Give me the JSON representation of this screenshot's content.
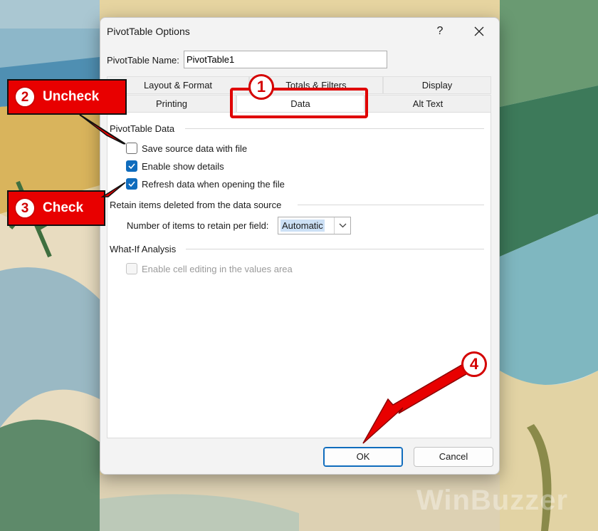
{
  "dialog": {
    "title": "PivotTable Options",
    "help_glyph": "?",
    "name_label": "PivotTable Name:",
    "name_label_accesskey": "N",
    "name_value": "PivotTable1"
  },
  "tabs": {
    "row1": [
      "Layout & Format",
      "Totals & Filters",
      "Display"
    ],
    "row2": [
      "Printing",
      "Data",
      "Alt Text"
    ],
    "active": "Data"
  },
  "data_tab": {
    "pivot_section": "PivotTable Data",
    "save_source_label": "Save source data with file",
    "save_source_checked": false,
    "enable_details_label": "Enable show details",
    "enable_details_checked": true,
    "refresh_label": "Refresh data when opening the file",
    "refresh_checked": true,
    "retain_section": "Retain items deleted from the data source",
    "retain_label": "Number of items to retain per field:",
    "retain_value": "Automatic",
    "whatif_section": "What-If Analysis",
    "cell_editing_label": "Enable cell editing in the values area",
    "cell_editing_checked": false,
    "cell_editing_enabled": false
  },
  "buttons": {
    "ok": "OK",
    "cancel": "Cancel"
  },
  "annotations": {
    "step1": "1",
    "step2_num": "2",
    "step2_text": "Uncheck",
    "step3_num": "3",
    "step3_text": "Check",
    "step4": "4"
  },
  "watermark": "WinBuzzer",
  "colors": {
    "accent": "#0f6cbd",
    "annotation_red": "#e80000"
  }
}
